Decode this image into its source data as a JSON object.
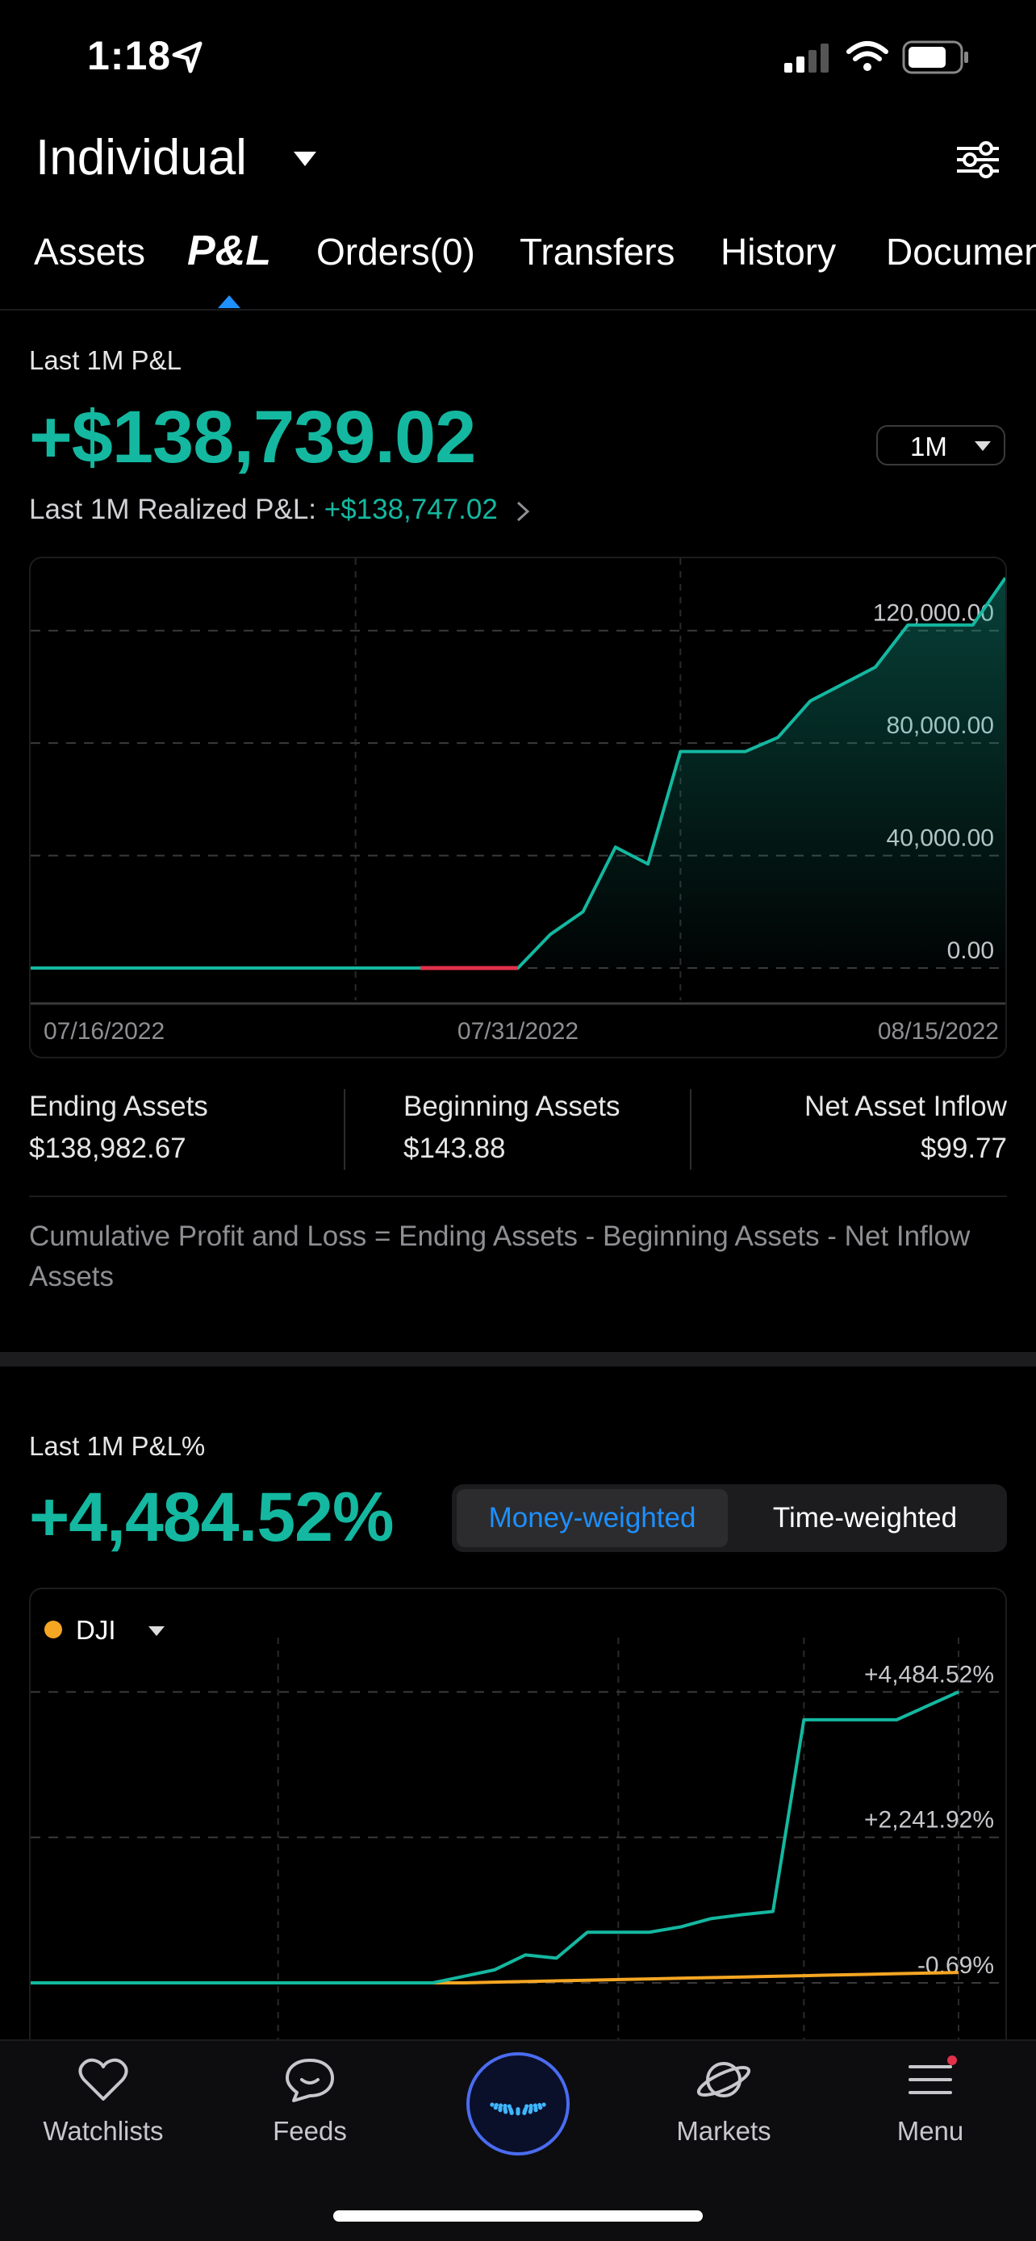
{
  "status_bar": {
    "time": "1:18"
  },
  "header": {
    "account": "Individual"
  },
  "tabs": [
    {
      "label": "Assets"
    },
    {
      "label": "P&L"
    },
    {
      "label": "Orders(0)"
    },
    {
      "label": "Transfers"
    },
    {
      "label": "History"
    },
    {
      "label": "Documents"
    }
  ],
  "pnl": {
    "title": "Last 1M P&L",
    "value": "+$138,739.02",
    "range": "1M",
    "realized_label": "Last 1M Realized P&L:",
    "realized_value": "+$138,747.02"
  },
  "stats": {
    "ending_label": "Ending Assets",
    "ending_value": "$138,982.67",
    "beginning_label": "Beginning Assets",
    "beginning_value": "$143.88",
    "inflow_label": "Net Asset Inflow",
    "inflow_value": "$99.77",
    "formula": "Cumulative Profit and Loss = Ending Assets - Beginning Assets - Net Inflow Assets"
  },
  "pct": {
    "title": "Last 1M P&L%",
    "value": "+4,484.52%",
    "money_label": "Money-weighted",
    "time_label": "Time-weighted",
    "benchmark": "DJI"
  },
  "nav": {
    "watchlists": "Watchlists",
    "feeds": "Feeds",
    "markets": "Markets",
    "menu": "Menu"
  },
  "colors": {
    "accent": "#14b8a0",
    "loss": "#e0314b",
    "benchmark": "#f5a623",
    "selected": "#1e90ff",
    "background": "#000000"
  },
  "chart_data": [
    {
      "type": "area",
      "x_tick_labels": [
        "07/16/2022",
        "07/31/2022",
        "08/15/2022"
      ],
      "y_tick_labels": [
        "0.00",
        "40,000.00",
        "80,000.00",
        "120,000.00"
      ],
      "ylim": [
        0,
        140000
      ],
      "xlim": [
        0,
        30
      ],
      "grid": true,
      "series": [
        {
          "x": [
            0,
            12,
            15,
            16,
            17,
            18,
            19,
            20,
            21,
            22,
            23,
            24,
            25,
            26,
            27,
            28,
            29,
            30
          ],
          "values": [
            0,
            0,
            0,
            12000,
            20000,
            43000,
            37000,
            77000,
            77000,
            77000,
            82000,
            95000,
            101000,
            107000,
            122000,
            122000,
            122000,
            138739
          ]
        }
      ]
    },
    {
      "type": "line",
      "y_tick_labels": [
        "+4,484.52%",
        "+2,241.92%",
        "-0.69%"
      ],
      "ylim": [
        -150,
        4700
      ],
      "xlim": [
        0,
        30
      ],
      "grid": true,
      "series": [
        {
          "name": "DJI",
          "x": [
            0,
            14,
            15,
            16,
            17,
            18,
            19,
            20,
            21,
            22,
            23,
            24,
            25,
            26,
            27,
            28,
            29,
            30
          ],
          "values": [
            -0.69,
            -0.69,
            10,
            20,
            30,
            40,
            50,
            60,
            70,
            80,
            90,
            100,
            110,
            120,
            130,
            140,
            150,
            160
          ]
        },
        {
          "x": [
            0,
            13,
            14,
            15,
            16,
            17,
            18,
            19,
            20,
            21,
            22,
            23,
            24,
            25,
            26,
            27,
            28,
            30
          ],
          "values": [
            0,
            0,
            100,
            200,
            430,
            380,
            780,
            780,
            780,
            860,
            990,
            1050,
            1100,
            4055,
            4055,
            4055,
            4055,
            4484.52
          ]
        }
      ]
    }
  ]
}
